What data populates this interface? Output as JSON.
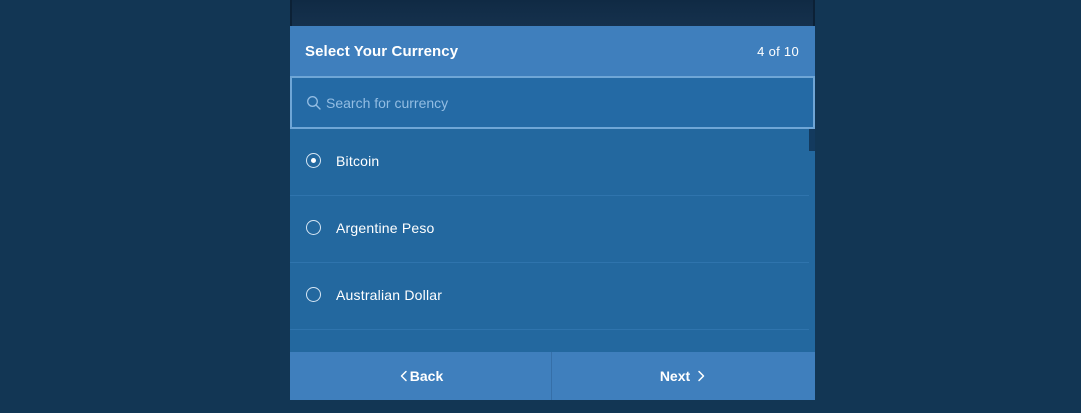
{
  "header": {
    "title": "Select Your Currency",
    "step": "4 of 10"
  },
  "search": {
    "placeholder": "Search for currency",
    "value": ""
  },
  "currencies": [
    {
      "label": "Bitcoin",
      "selected": true
    },
    {
      "label": "Argentine Peso",
      "selected": false
    },
    {
      "label": "Australian Dollar",
      "selected": false
    }
  ],
  "footer": {
    "back_label": "Back",
    "next_label": "Next"
  },
  "icons": {
    "search": "search-icon",
    "back": "chevron-left-icon",
    "next": "chevron-right-icon"
  },
  "colors": {
    "background": "#123654",
    "panel": "#23689f",
    "header": "#3f7fbd",
    "search_border": "#6fa6d6"
  }
}
